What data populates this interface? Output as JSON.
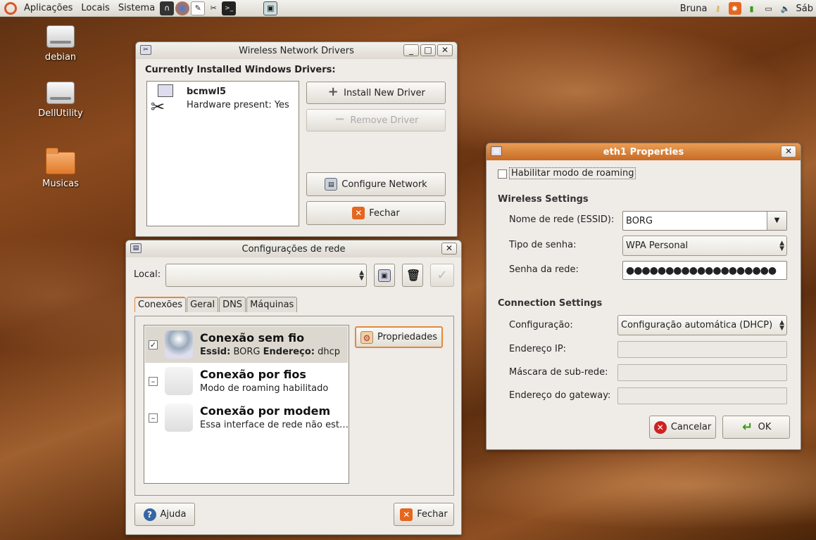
{
  "panel": {
    "menus": [
      "Aplicações",
      "Locais",
      "Sistema"
    ],
    "user": "Bruna",
    "clock": "Sáb"
  },
  "desktop": {
    "icons": [
      "debian",
      "DellUtility",
      "Musicas"
    ]
  },
  "drivers_window": {
    "title": "Wireless Network Drivers",
    "heading": "Currently Installed Windows Drivers:",
    "driver_name": "bcmwl5",
    "driver_status": "Hardware present: Yes",
    "install": "Install New Driver",
    "remove": "Remove Driver",
    "configure": "Configure Network",
    "close": "Fechar"
  },
  "network_window": {
    "title": "Configurações de rede",
    "local_label": "Local:",
    "local_value": "",
    "tabs": [
      "Conexões",
      "Geral",
      "DNS",
      "Máquinas"
    ],
    "connections": [
      {
        "title": "Conexão sem fio",
        "sub_prefix": "Essid:",
        "essid": "BORG",
        "addr_label": "Endereço:",
        "addr": "dhcp",
        "checked": "✓"
      },
      {
        "title": "Conexão por fios",
        "sub": "Modo de roaming habilitado",
        "checked": "–"
      },
      {
        "title": "Conexão por modem",
        "sub": "Essa interface de rede não est…",
        "checked": "–"
      }
    ],
    "properties": "Propriedades",
    "help": "Ajuda",
    "close": "Fechar"
  },
  "eth1_window": {
    "title": "eth1 Properties",
    "roaming": "Habilitar modo de roaming",
    "wireless_header": "Wireless Settings",
    "essid_label": "Nome de rede (ESSID):",
    "essid": "BORG",
    "pwtype_label": "Tipo de senha:",
    "pwtype": "WPA Personal",
    "password_label": "Senha da rede:",
    "password": "●●●●●●●●●●●●●●●●●●●",
    "connection_header": "Connection Settings",
    "config_label": "Configuração:",
    "config": "Configuração automática (DHCP)",
    "ip_label": "Endereço IP:",
    "mask_label": "Máscara de sub-rede:",
    "gateway_label": "Endereço do gateway:",
    "cancel": "Cancelar",
    "ok": "OK"
  },
  "colors": {
    "accent": "#e08a3c",
    "titlebar_active": "#d27a30"
  }
}
